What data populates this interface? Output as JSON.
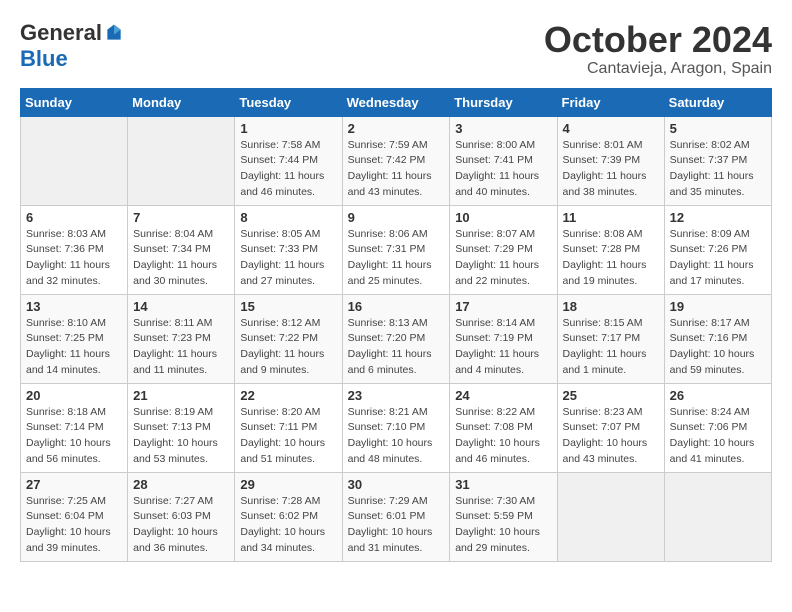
{
  "logo": {
    "general": "General",
    "blue": "Blue"
  },
  "title": {
    "month": "October 2024",
    "location": "Cantavieja, Aragon, Spain"
  },
  "headers": [
    "Sunday",
    "Monday",
    "Tuesday",
    "Wednesday",
    "Thursday",
    "Friday",
    "Saturday"
  ],
  "weeks": [
    [
      {
        "day": "",
        "sunrise": "",
        "sunset": "",
        "daylight": ""
      },
      {
        "day": "",
        "sunrise": "",
        "sunset": "",
        "daylight": ""
      },
      {
        "day": "1",
        "sunrise": "Sunrise: 7:58 AM",
        "sunset": "Sunset: 7:44 PM",
        "daylight": "Daylight: 11 hours and 46 minutes."
      },
      {
        "day": "2",
        "sunrise": "Sunrise: 7:59 AM",
        "sunset": "Sunset: 7:42 PM",
        "daylight": "Daylight: 11 hours and 43 minutes."
      },
      {
        "day": "3",
        "sunrise": "Sunrise: 8:00 AM",
        "sunset": "Sunset: 7:41 PM",
        "daylight": "Daylight: 11 hours and 40 minutes."
      },
      {
        "day": "4",
        "sunrise": "Sunrise: 8:01 AM",
        "sunset": "Sunset: 7:39 PM",
        "daylight": "Daylight: 11 hours and 38 minutes."
      },
      {
        "day": "5",
        "sunrise": "Sunrise: 8:02 AM",
        "sunset": "Sunset: 7:37 PM",
        "daylight": "Daylight: 11 hours and 35 minutes."
      }
    ],
    [
      {
        "day": "6",
        "sunrise": "Sunrise: 8:03 AM",
        "sunset": "Sunset: 7:36 PM",
        "daylight": "Daylight: 11 hours and 32 minutes."
      },
      {
        "day": "7",
        "sunrise": "Sunrise: 8:04 AM",
        "sunset": "Sunset: 7:34 PM",
        "daylight": "Daylight: 11 hours and 30 minutes."
      },
      {
        "day": "8",
        "sunrise": "Sunrise: 8:05 AM",
        "sunset": "Sunset: 7:33 PM",
        "daylight": "Daylight: 11 hours and 27 minutes."
      },
      {
        "day": "9",
        "sunrise": "Sunrise: 8:06 AM",
        "sunset": "Sunset: 7:31 PM",
        "daylight": "Daylight: 11 hours and 25 minutes."
      },
      {
        "day": "10",
        "sunrise": "Sunrise: 8:07 AM",
        "sunset": "Sunset: 7:29 PM",
        "daylight": "Daylight: 11 hours and 22 minutes."
      },
      {
        "day": "11",
        "sunrise": "Sunrise: 8:08 AM",
        "sunset": "Sunset: 7:28 PM",
        "daylight": "Daylight: 11 hours and 19 minutes."
      },
      {
        "day": "12",
        "sunrise": "Sunrise: 8:09 AM",
        "sunset": "Sunset: 7:26 PM",
        "daylight": "Daylight: 11 hours and 17 minutes."
      }
    ],
    [
      {
        "day": "13",
        "sunrise": "Sunrise: 8:10 AM",
        "sunset": "Sunset: 7:25 PM",
        "daylight": "Daylight: 11 hours and 14 minutes."
      },
      {
        "day": "14",
        "sunrise": "Sunrise: 8:11 AM",
        "sunset": "Sunset: 7:23 PM",
        "daylight": "Daylight: 11 hours and 11 minutes."
      },
      {
        "day": "15",
        "sunrise": "Sunrise: 8:12 AM",
        "sunset": "Sunset: 7:22 PM",
        "daylight": "Daylight: 11 hours and 9 minutes."
      },
      {
        "day": "16",
        "sunrise": "Sunrise: 8:13 AM",
        "sunset": "Sunset: 7:20 PM",
        "daylight": "Daylight: 11 hours and 6 minutes."
      },
      {
        "day": "17",
        "sunrise": "Sunrise: 8:14 AM",
        "sunset": "Sunset: 7:19 PM",
        "daylight": "Daylight: 11 hours and 4 minutes."
      },
      {
        "day": "18",
        "sunrise": "Sunrise: 8:15 AM",
        "sunset": "Sunset: 7:17 PM",
        "daylight": "Daylight: 11 hours and 1 minute."
      },
      {
        "day": "19",
        "sunrise": "Sunrise: 8:17 AM",
        "sunset": "Sunset: 7:16 PM",
        "daylight": "Daylight: 10 hours and 59 minutes."
      }
    ],
    [
      {
        "day": "20",
        "sunrise": "Sunrise: 8:18 AM",
        "sunset": "Sunset: 7:14 PM",
        "daylight": "Daylight: 10 hours and 56 minutes."
      },
      {
        "day": "21",
        "sunrise": "Sunrise: 8:19 AM",
        "sunset": "Sunset: 7:13 PM",
        "daylight": "Daylight: 10 hours and 53 minutes."
      },
      {
        "day": "22",
        "sunrise": "Sunrise: 8:20 AM",
        "sunset": "Sunset: 7:11 PM",
        "daylight": "Daylight: 10 hours and 51 minutes."
      },
      {
        "day": "23",
        "sunrise": "Sunrise: 8:21 AM",
        "sunset": "Sunset: 7:10 PM",
        "daylight": "Daylight: 10 hours and 48 minutes."
      },
      {
        "day": "24",
        "sunrise": "Sunrise: 8:22 AM",
        "sunset": "Sunset: 7:08 PM",
        "daylight": "Daylight: 10 hours and 46 minutes."
      },
      {
        "day": "25",
        "sunrise": "Sunrise: 8:23 AM",
        "sunset": "Sunset: 7:07 PM",
        "daylight": "Daylight: 10 hours and 43 minutes."
      },
      {
        "day": "26",
        "sunrise": "Sunrise: 8:24 AM",
        "sunset": "Sunset: 7:06 PM",
        "daylight": "Daylight: 10 hours and 41 minutes."
      }
    ],
    [
      {
        "day": "27",
        "sunrise": "Sunrise: 7:25 AM",
        "sunset": "Sunset: 6:04 PM",
        "daylight": "Daylight: 10 hours and 39 minutes."
      },
      {
        "day": "28",
        "sunrise": "Sunrise: 7:27 AM",
        "sunset": "Sunset: 6:03 PM",
        "daylight": "Daylight: 10 hours and 36 minutes."
      },
      {
        "day": "29",
        "sunrise": "Sunrise: 7:28 AM",
        "sunset": "Sunset: 6:02 PM",
        "daylight": "Daylight: 10 hours and 34 minutes."
      },
      {
        "day": "30",
        "sunrise": "Sunrise: 7:29 AM",
        "sunset": "Sunset: 6:01 PM",
        "daylight": "Daylight: 10 hours and 31 minutes."
      },
      {
        "day": "31",
        "sunrise": "Sunrise: 7:30 AM",
        "sunset": "Sunset: 5:59 PM",
        "daylight": "Daylight: 10 hours and 29 minutes."
      },
      {
        "day": "",
        "sunrise": "",
        "sunset": "",
        "daylight": ""
      },
      {
        "day": "",
        "sunrise": "",
        "sunset": "",
        "daylight": ""
      }
    ]
  ]
}
